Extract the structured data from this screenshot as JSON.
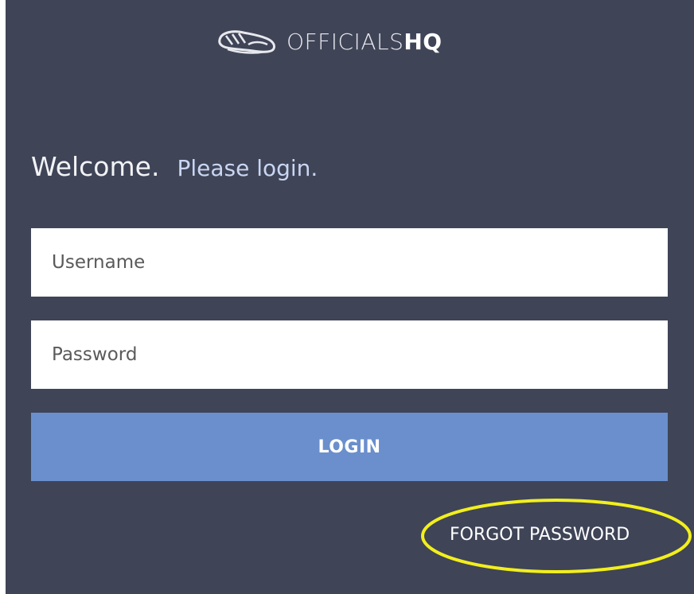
{
  "brand": {
    "name_light": "OFFICIALS",
    "name_bold": "HQ",
    "logo_icon": "shoe-logo-icon"
  },
  "welcome": {
    "title": "Welcome.",
    "subtitle": "Please login."
  },
  "form": {
    "username_placeholder": "Username",
    "password_placeholder": "Password",
    "login_label": "LOGIN",
    "forgot_label": "FORGOT PASSWORD"
  },
  "colors": {
    "background": "#3f4457",
    "button": "#6a8fcc",
    "welcome_subtitle": "#c9d6f2",
    "annotation": "#f2ef1c"
  }
}
